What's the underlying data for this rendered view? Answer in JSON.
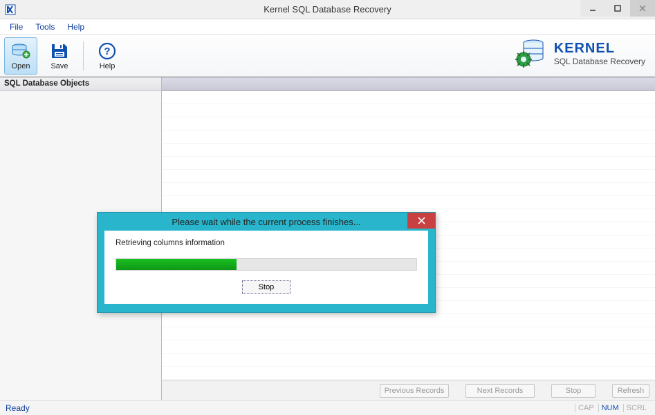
{
  "titlebar": {
    "app_name": "Kernel SQL Database Recovery"
  },
  "menu": {
    "file": "File",
    "tools": "Tools",
    "help": "Help"
  },
  "toolbar": {
    "open": "Open",
    "save": "Save",
    "help": "Help"
  },
  "brand": {
    "name": "KERNEL",
    "sub": "SQL Database Recovery"
  },
  "sidebar": {
    "header": "SQL Database Objects"
  },
  "bottom": {
    "prev": "Previous Records",
    "next": "Next Records",
    "stop": "Stop",
    "refresh": "Refresh"
  },
  "status": {
    "ready": "Ready",
    "cap": "CAP",
    "num": "NUM",
    "scrl": "SCRL"
  },
  "dialog": {
    "title": "Please wait while the current process finishes...",
    "message": "Retrieving columns information",
    "stop": "Stop",
    "progress_percent": 40
  }
}
